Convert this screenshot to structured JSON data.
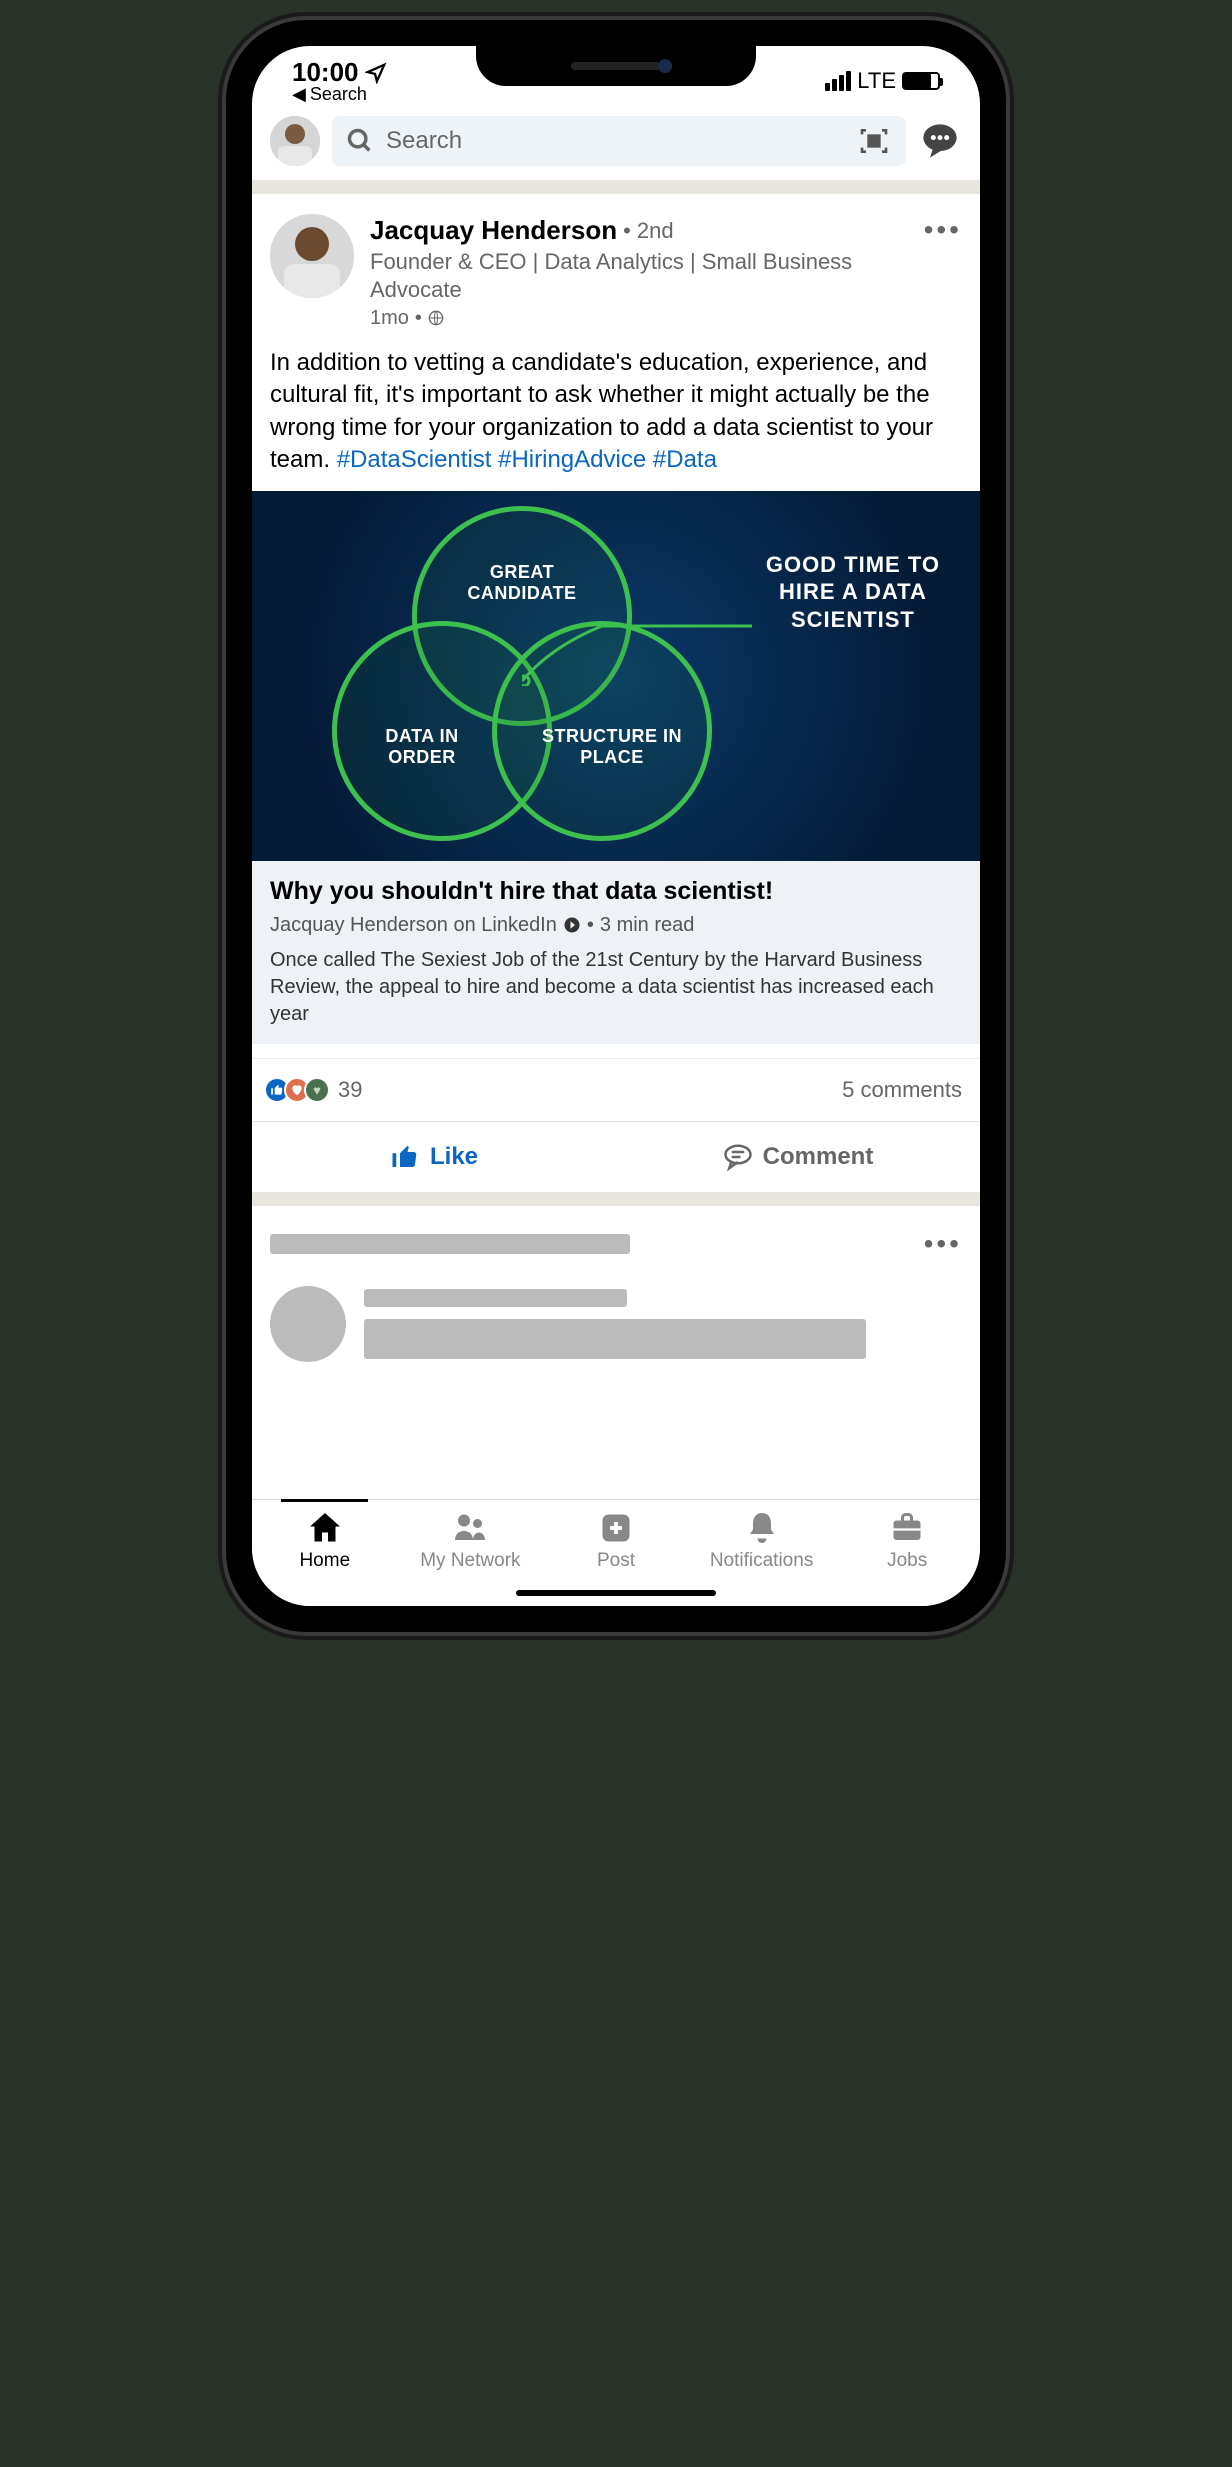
{
  "status": {
    "time": "10:00",
    "back_label": "Search",
    "network": "LTE"
  },
  "topbar": {
    "search_placeholder": "Search"
  },
  "post": {
    "author_name": "Jacquay Henderson",
    "degree": "2nd",
    "headline": "Founder & CEO | Data Analytics | Small Business Advocate",
    "time": "1mo",
    "body_text": "In addition to vetting a candidate's education, experience, and cultural fit, it's important to ask whether it might actually be the wrong time for your organization to add a data scientist to your team. ",
    "hashtags": [
      "#DataScientist",
      "#HiringAdvice",
      "#Data"
    ],
    "venn": {
      "top": "GREAT CANDIDATE",
      "left": "DATA IN ORDER",
      "right": "STRUCTURE IN PLACE",
      "callout_l1": "GOOD TIME TO",
      "callout_l2": "HIRE A DATA",
      "callout_l3": "SCIENTIST"
    },
    "article": {
      "title": "Why you shouldn't hire that data scientist!",
      "source": "Jacquay Henderson on LinkedIn",
      "read_time": "3 min read",
      "description": "Once called The Sexiest Job of the 21st Century by the Harvard Business Review, the appeal to hire and become a data scientist has increased each year"
    },
    "reactions_count": "39",
    "comments_text": "5 comments",
    "like_label": "Like",
    "comment_label": "Comment"
  },
  "nav": {
    "home": "Home",
    "network": "My Network",
    "post": "Post",
    "notifications": "Notifications",
    "jobs": "Jobs"
  }
}
